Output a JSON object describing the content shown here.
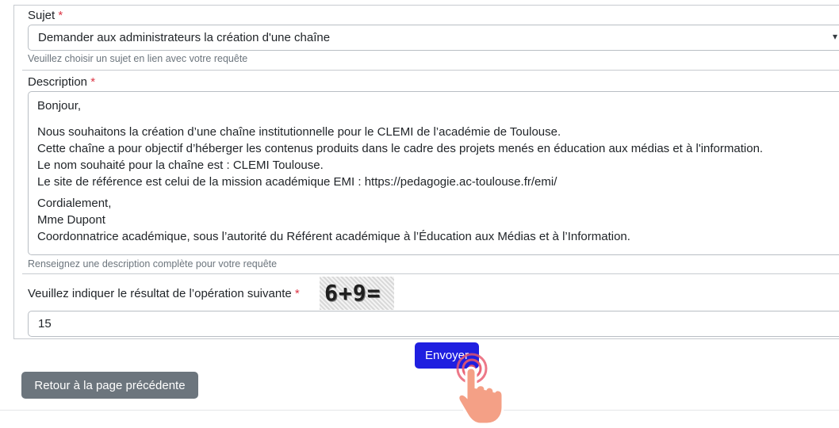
{
  "form": {
    "subject": {
      "label": "Sujet",
      "required_mark": "*",
      "selected": "Demander aux administrateurs la création d'une chaîne",
      "help": "Veuillez choisir un sujet en lien avec votre requête"
    },
    "description": {
      "label": "Description",
      "required_mark": "*",
      "paragraphs": [
        [
          "Bonjour,"
        ],
        [
          "Nous souhaitons la création d’une chaîne institutionnelle pour le CLEMI de l’académie de Toulouse.",
          "Cette chaîne a pour objectif d’héberger les contenus produits dans le cadre des projets menés en éducation aux médias et à l'information.",
          "Le nom souhaité pour la chaîne est : CLEMI Toulouse.",
          "Le site de référence est celui de la mission académique EMI : https://pedagogie.ac-toulouse.fr/emi/"
        ],
        [
          "Cordialement,",
          "Mme Dupont",
          "Coordonnatrice académique, sous l’autorité du Référent académique à l’Éducation aux Médias et à l’Information."
        ]
      ],
      "help": "Renseignez une description complète pour votre requête"
    },
    "captcha": {
      "label": "Veuillez indiquer le résultat de l’opération suivante",
      "required_mark": "*",
      "image_text": "6+9=",
      "answer": "15"
    }
  },
  "buttons": {
    "submit": "Envoyer",
    "back": "Retour à la page précédente"
  },
  "colors": {
    "primary": "#1f1fe0",
    "secondary": "#6c757d",
    "required": "#dc3545"
  }
}
